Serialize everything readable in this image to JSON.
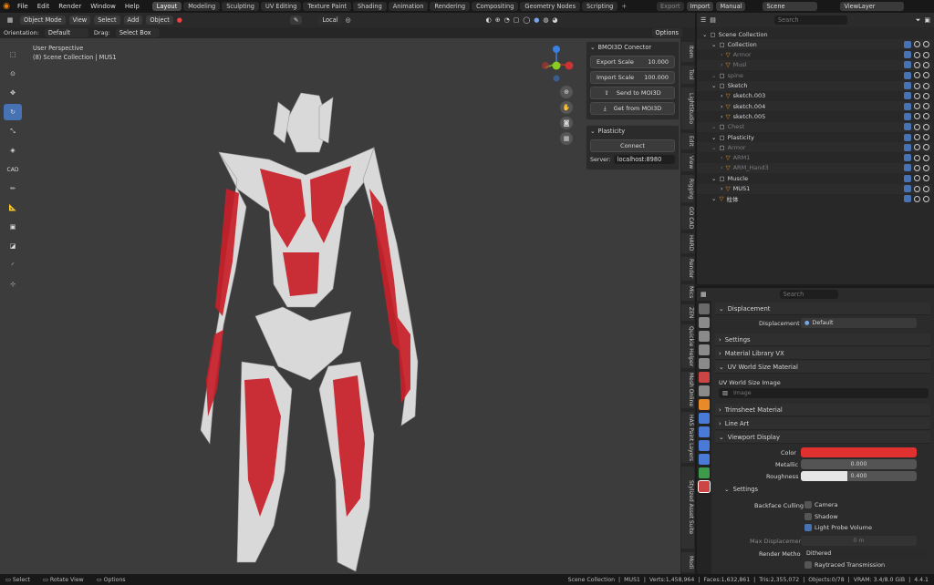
{
  "menu": {
    "file": "File",
    "edit": "Edit",
    "render": "Render",
    "window": "Window",
    "help": "Help"
  },
  "workspaces": [
    "Layout",
    "Modeling",
    "Sculpting",
    "UV Editing",
    "Texture Paint",
    "Shading",
    "Animation",
    "Rendering",
    "Compositing",
    "Geometry Nodes",
    "Scripting"
  ],
  "top_right": {
    "export": "Export",
    "import": "Import",
    "manual": "Manual",
    "scene": "Scene",
    "view_layer": "ViewLayer"
  },
  "header": {
    "mode": "Object Mode",
    "view": "View",
    "select": "Select",
    "add": "Add",
    "object": "Object",
    "pivot": "Local",
    "options": "Options"
  },
  "header2": {
    "orientation_label": "Orientation:",
    "orientation": "Default",
    "drag_label": "Drag:",
    "drag": "Select Box"
  },
  "viewport": {
    "line1": "User Perspective",
    "line2": "(8) Scene Collection | MUS1"
  },
  "moi3d": {
    "title": "BMOI3D Conector",
    "export_label": "Export Scale",
    "export_value": "10.000",
    "import_label": "Import Scale",
    "import_value": "100.000",
    "send": "Send to MOI3D",
    "get": "Get from MOI3D"
  },
  "plasticity": {
    "title": "Plasticity",
    "connect": "Connect",
    "server_label": "Server:",
    "server": "localhost:8980"
  },
  "side_tabs": [
    "Item",
    "Tool",
    "LightStudio",
    "Edit",
    "View",
    "Rigging",
    "GO CAD",
    "HARD",
    "Render",
    "Mics",
    "ZEN",
    "Quickie Helper",
    "Mesh Online",
    "HAS Paint Layers",
    "Stylized Asset Suite",
    "Modi"
  ],
  "outliner": {
    "search_placeholder": "Search",
    "rows": [
      {
        "name": "Scene Collection",
        "indent": 0
      },
      {
        "name": "Collection",
        "indent": 1
      },
      {
        "name": "Armor",
        "indent": 2,
        "dim": true
      },
      {
        "name": "Musl",
        "indent": 2,
        "dim": true
      },
      {
        "name": "spine",
        "indent": 1,
        "dim": true
      },
      {
        "name": "Sketch",
        "indent": 1
      },
      {
        "name": "sketch.003",
        "indent": 2
      },
      {
        "name": "sketch.004",
        "indent": 2
      },
      {
        "name": "sketch.005",
        "indent": 2
      },
      {
        "name": "Chest",
        "indent": 1,
        "dim": true
      },
      {
        "name": "Plasticity",
        "indent": 1
      },
      {
        "name": "Armor",
        "indent": 1,
        "dim": true
      },
      {
        "name": "ARM1",
        "indent": 2,
        "dim": true
      },
      {
        "name": "ARM_Hand3",
        "indent": 2,
        "dim": true
      },
      {
        "name": "Muscle",
        "indent": 1
      },
      {
        "name": "MUS1",
        "indent": 2
      },
      {
        "name": "柱体",
        "indent": 1
      }
    ]
  },
  "properties": {
    "search_placeholder": "Search",
    "displacement_section": "Displacement",
    "displacement_label": "Displacement",
    "displacement_value": "Default",
    "settings": "Settings",
    "material_library": "Material Library VX",
    "uv_world": "UV World Size Material",
    "uv_world_image": "UV World Size Image",
    "image_placeholder": "Image",
    "trimsheet": "Trimsheet Material",
    "line_art": "Line Art",
    "viewport_display": "Viewport Display",
    "color_label": "Color",
    "color_hex": "#e03030",
    "metallic_label": "Metallic",
    "metallic_value": "0.000",
    "roughness_label": "Roughness",
    "roughness_value": "0.400",
    "roughness_fill": 0.4,
    "settings2": "Settings",
    "backface_label": "Backface Culling",
    "camera": "Camera",
    "shadow": "Shadow",
    "light_probe": "Light Probe Volume",
    "max_disp_label": "Max Displacement",
    "max_disp_value": "0 m",
    "render_method_label": "Render Method",
    "render_method": "Dithered",
    "raytraced": "Raytraced Transmission"
  },
  "status": {
    "select": "Select",
    "rotate": "Rotate View",
    "options": "Options",
    "collection": "Scene Collection",
    "object": "MUS1",
    "verts": "Verts:1,458,964",
    "faces": "Faces:1,632,861",
    "tris": "Tris:2,355,072",
    "objects": "Objects:0/78",
    "vram": "VRAM: 3.4/8.0 GiB",
    "version": "4.4.1"
  },
  "colors": {
    "accent": "#4772b3",
    "muscle": "#c8202a",
    "mesh": "#d8d8d8"
  }
}
